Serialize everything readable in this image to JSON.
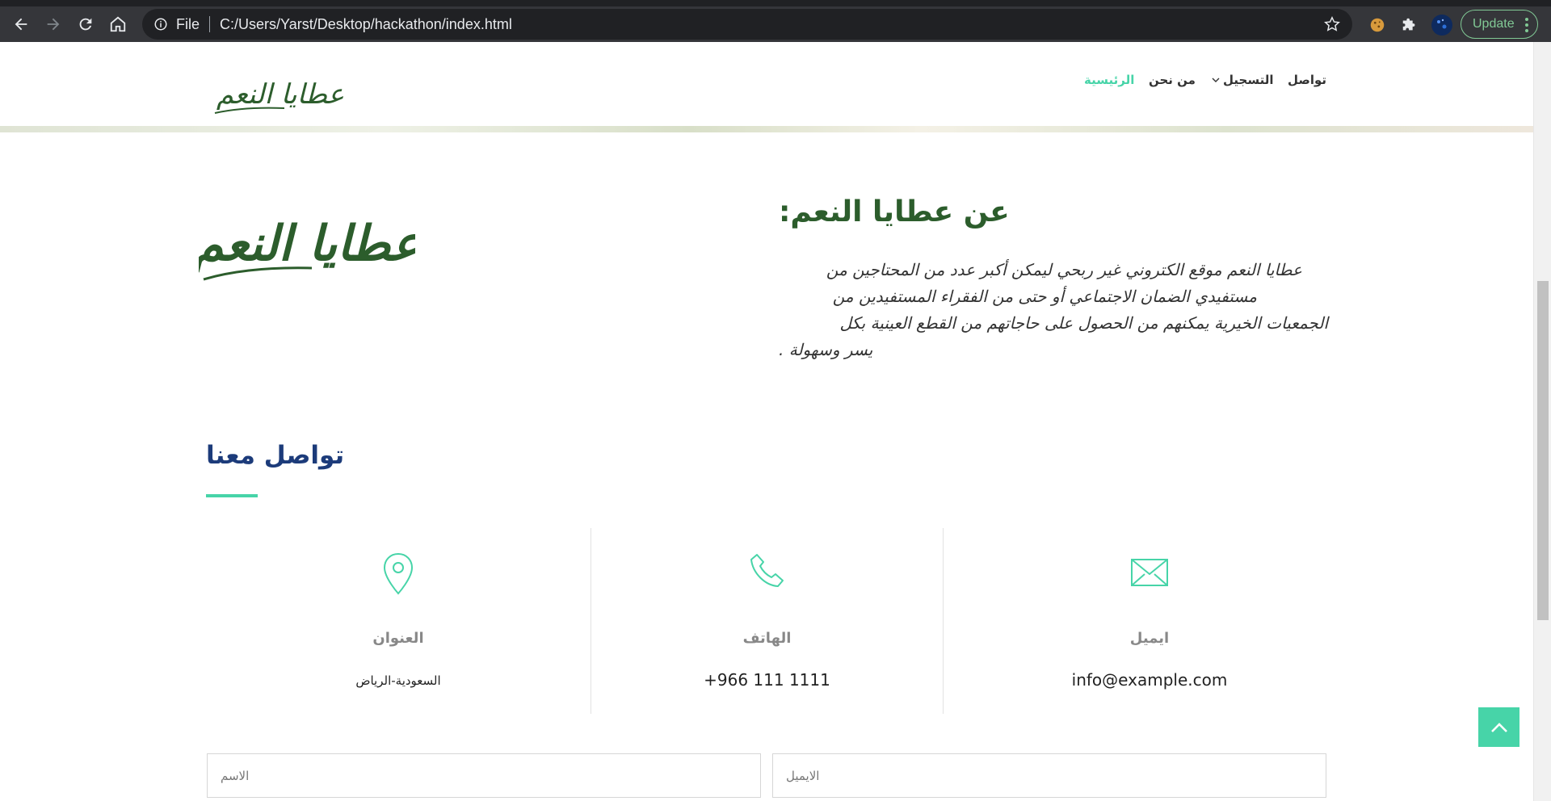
{
  "browser": {
    "url_scheme": "File",
    "url_path": "C:/Users/Yarst/Desktop/hackathon/index.html",
    "update_label": "Update"
  },
  "header": {
    "logo_text": "عطايا النعم",
    "nav": {
      "home": "الرئيسية",
      "about": "من نحن",
      "register": "التسجيل",
      "contact": "تواصل"
    }
  },
  "about": {
    "title": "عن عطايا النعم:",
    "logo_text": "عطايا النعم",
    "lines": [
      "عطايا النعم موقع الكتروني غير ربحي ليمكن أكبر عدد من المحتاجين من",
      "مستفيدي الضمان الاجتماعي أو حتى من الفقراء المستفيدين من",
      "الجمعيات الخيرية يمكنهم من الحصول على حاجاتهم من القطع العينية بكل",
      "يسر وسهولة ."
    ]
  },
  "contact": {
    "title": "تواصل معنا",
    "address": {
      "label": "العنوان",
      "value": "السعودية-الرياض"
    },
    "phone": {
      "label": "الهاتف",
      "value": "+966 111 1111"
    },
    "email": {
      "label": "ايميل",
      "value": "info@example.com"
    }
  },
  "form": {
    "name_placeholder": "الاسم",
    "email_placeholder": "الايميل"
  },
  "colors": {
    "accent": "#47d4a8",
    "heading_green": "#2c5d2c",
    "heading_blue": "#1c3b7a"
  }
}
